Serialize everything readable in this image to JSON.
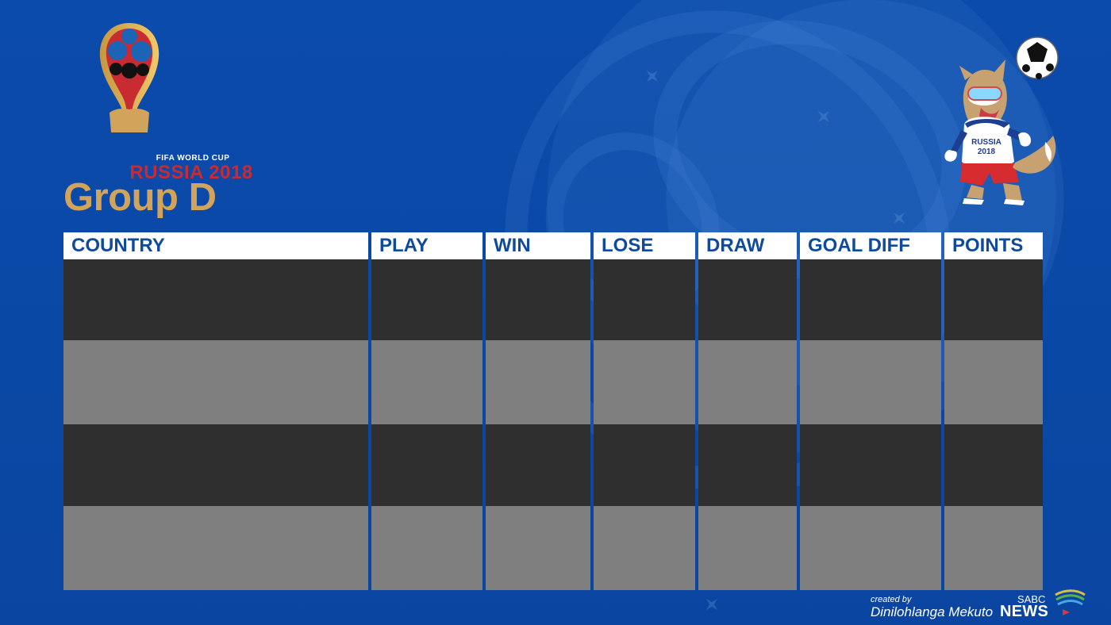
{
  "header": {
    "logo_subtitle": "FIFA WORLD CUP",
    "logo_title": "RUSSIA 2018",
    "group_title": "Group D"
  },
  "mascot": {
    "shirt_text_line1": "RUSSIA",
    "shirt_text_line2": "2018"
  },
  "table": {
    "columns": [
      {
        "label": "COUNTRY"
      },
      {
        "label": "PLAY"
      },
      {
        "label": "WIN"
      },
      {
        "label": "LOSE"
      },
      {
        "label": "DRAW"
      },
      {
        "label": "GOAL DIFF"
      },
      {
        "label": "POINTS"
      }
    ]
  },
  "footer": {
    "created_by_label": "created by",
    "creator_name": "Dinilohlanga Mekuto",
    "brand_small": "SABC",
    "brand_main": "NEWS"
  },
  "colors": {
    "background": "#0a4aa8",
    "header_text": "#0f4a9c",
    "title_gold": "#d2a35b",
    "dark_row": "#2f2f2f",
    "light_row": "#7f7f7f",
    "logo_red": "#c92b32"
  }
}
